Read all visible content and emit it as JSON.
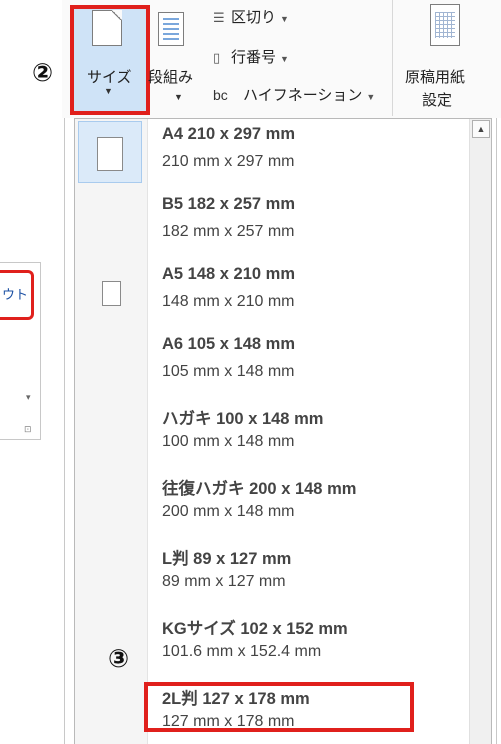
{
  "background_window": {
    "tab_label": "ウト"
  },
  "ribbon": {
    "size_button": {
      "label": "サイズ"
    },
    "columns_button": {
      "label": "段組み"
    },
    "breaks": {
      "label": "区切り"
    },
    "line_numbers": {
      "label": "行番号"
    },
    "hyphenation": {
      "label": "ハイフネーション",
      "icon_text": "bc"
    },
    "genko": {
      "line1": "原稿用紙",
      "line2": "設定"
    }
  },
  "markers": {
    "step2": "②",
    "step3": "③"
  },
  "page_sizes": [
    {
      "title": "A4 210 x 297 mm",
      "sub": "210 mm x 297 mm",
      "selected": true
    },
    {
      "title": "B5 182 x 257 mm",
      "sub": "182 mm x 257 mm"
    },
    {
      "title": "A5 148 x 210 mm",
      "sub": "148 mm x 210 mm"
    },
    {
      "title": "A6 105 x 148 mm",
      "sub": "105 mm x 148 mm"
    },
    {
      "title": "ハガキ 100 x 148 mm",
      "sub": "100 mm x 148 mm"
    },
    {
      "title": "往復ハガキ 200 x 148 mm",
      "sub": "200 mm x 148 mm"
    },
    {
      "title": "L判 89 x 127 mm",
      "sub": "89 mm x 127 mm"
    },
    {
      "title": "KGサイズ 102 x 152 mm",
      "sub": "101.6 mm x 152.4 mm"
    },
    {
      "title": "2L判 127 x 178 mm",
      "sub": "127 mm x 178 mm"
    }
  ],
  "colors": {
    "highlight_red": "#e0201c",
    "selected_bg": "#cfe3f7"
  }
}
